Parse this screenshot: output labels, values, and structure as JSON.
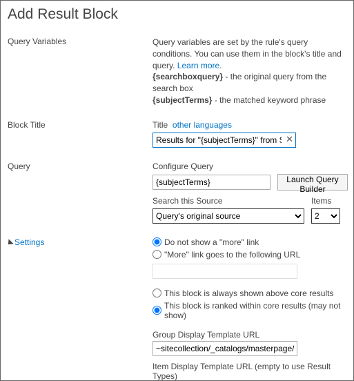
{
  "header": {
    "title": "Add Result Block"
  },
  "queryVariables": {
    "heading": "Query Variables",
    "desc_prefix": "Query variables are set by the rule's query conditions. You can use them in the block's title and query. ",
    "learn_more": "Learn more",
    "desc_suffix": ".",
    "var1_name": "{searchboxquery}",
    "var1_desc": " - the original query from the search box",
    "var2_name": "{subjectTerms}",
    "var2_desc": " - the matched keyword phrase"
  },
  "blockTitle": {
    "heading": "Block Title",
    "label": "Title",
    "other_lang": "other languages",
    "value": "Results for \"{subjectTerms}\" from SharePoint"
  },
  "query": {
    "heading": "Query",
    "configure_label": "Configure Query",
    "configure_value": "{subjectTerms}",
    "launch_btn": "Launch Query Builder",
    "source_label": "Search this Source",
    "source_value": "Query's original source",
    "items_label": "Items",
    "items_value": "2"
  },
  "settings": {
    "heading": "Settings",
    "more_none": "Do not show a \"more\" link",
    "more_url": "\"More\" link goes to the following URL",
    "more_url_value": "",
    "pos_above": "This block is always shown above core results",
    "pos_within": "This block is ranked within core results (may not show)",
    "group_tmpl_label": "Group Display Template URL",
    "group_tmpl_value": "~sitecollection/_catalogs/masterpage/Display Templates",
    "item_tmpl_label": "Item Display Template URL (empty to use Result Types)"
  }
}
